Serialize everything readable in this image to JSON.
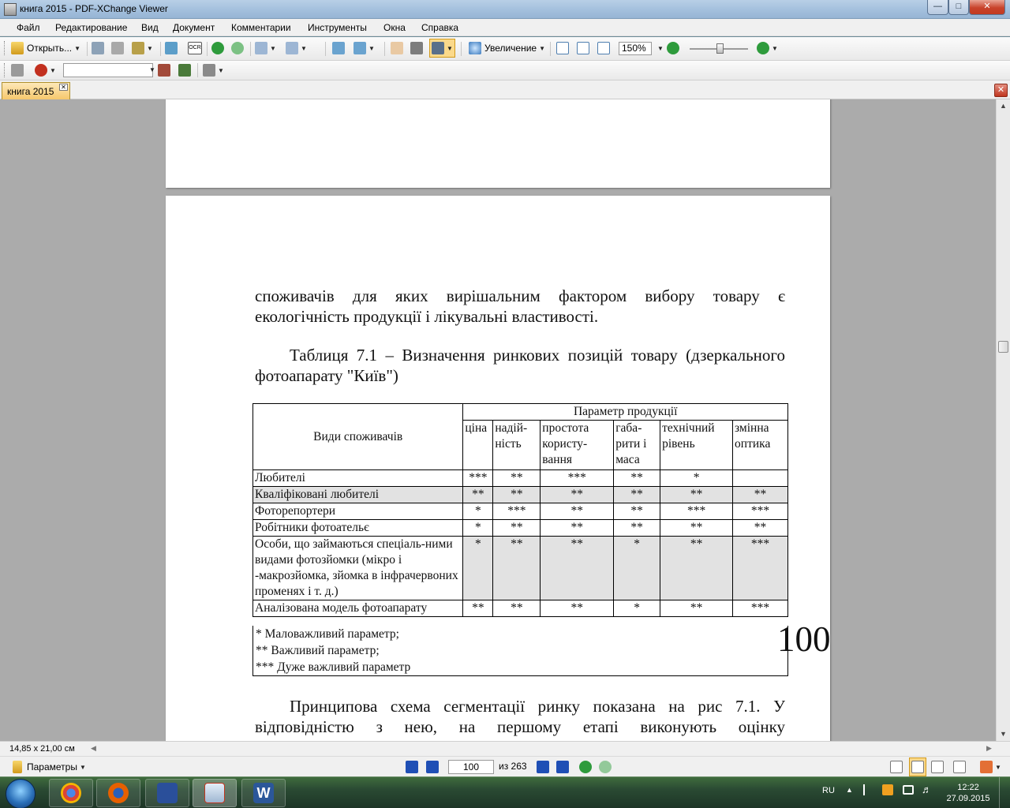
{
  "window": {
    "title": "книга 2015 - PDF-XChange Viewer"
  },
  "menu": [
    "Файл",
    "Редактирование",
    "Вид",
    "Документ",
    "Комментарии",
    "Инструменты",
    "Окна",
    "Справка"
  ],
  "toolbar": {
    "open_label": "Открыть...",
    "zoom_label": "Увеличение",
    "zoom_value": "150%",
    "ocr_label": "OCR",
    "find_value": ""
  },
  "tab": {
    "label": "книга 2015"
  },
  "document": {
    "para1_line1": "споживачів для яких вирішальним фактором вибору товару є",
    "para1_line2": "екологічність продукції і лікувальні властивості.",
    "caption_line1": "Таблиця 7.1 – Визначення ринкових позицій товару (дзеркального",
    "caption_line2": "фотоапарату \"Київ\")",
    "table": {
      "header_consumers": "Види споживачів",
      "header_params": "Параметр продукції",
      "columns": [
        "ціна",
        "надій-ність",
        "простота користу-вання",
        "габа-рити і маса",
        "технічний рівень",
        "змінна оптика"
      ],
      "rows": [
        {
          "name": "Любителі",
          "values": [
            "***",
            "**",
            "***",
            "**",
            "*",
            ""
          ]
        },
        {
          "name": "Кваліфіковані любителі",
          "values": [
            "**",
            "**",
            "**",
            "**",
            "**",
            "**"
          ]
        },
        {
          "name": "Фоторепортери",
          "values": [
            "*",
            "***",
            "**",
            "**",
            "***",
            "***"
          ]
        },
        {
          "name": "Робітники фотоательє",
          "values": [
            "*",
            "**",
            "**",
            "**",
            "**",
            "**"
          ]
        },
        {
          "name": "Особи, що займаються спеціаль-ними видами фотозйомки (мікро і -макрозйомка, зйомка в інфрачервоних променях і т. д.)",
          "values": [
            "*",
            "**",
            "**",
            "*",
            "**",
            "***"
          ]
        },
        {
          "name": "Аналізована модель фотоапарату",
          "values": [
            "**",
            "**",
            "**",
            "*",
            "**",
            "***"
          ]
        }
      ],
      "footnotes": [
        "*  Маловажливий параметр;",
        "**  Важливий параметр;",
        "***  Дуже важливий параметр"
      ]
    },
    "page_number": "100",
    "para2_line1": "Принципова схема сегментації ринку показана на рис 7.1. У",
    "para2_line2": "відповідністю з нею, на першому етапі виконують оцінку"
  },
  "status": {
    "page_size": "14,85 x 21,00 см",
    "params_label": "Параметры",
    "current_page": "100",
    "of_pages": "из 263"
  },
  "taskbar": {
    "lang": "RU",
    "time": "12:22",
    "date": "27.09.2015"
  },
  "colors": {
    "accent_tab": "#f6c86c",
    "nav_green": "#2e9b3c",
    "nav_blue": "#1f4fb5",
    "close_red": "#c8432b"
  }
}
